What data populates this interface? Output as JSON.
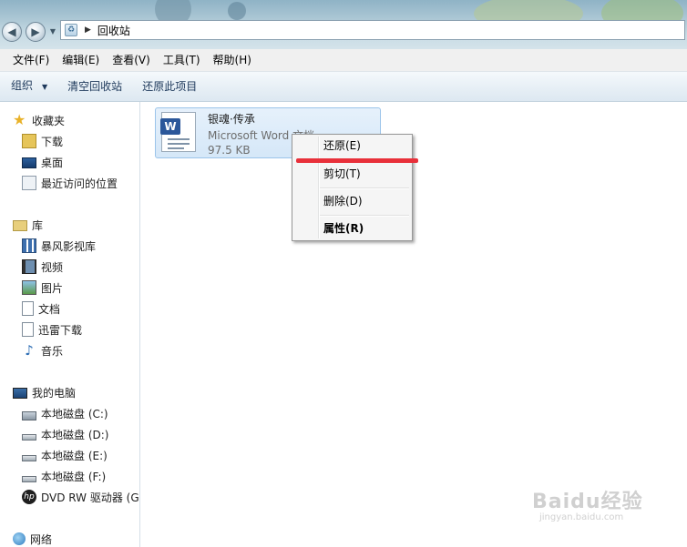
{
  "address": {
    "path": "回收站"
  },
  "menubar": {
    "items": [
      {
        "label": "文件(F)"
      },
      {
        "label": "编辑(E)"
      },
      {
        "label": "查看(V)"
      },
      {
        "label": "工具(T)"
      },
      {
        "label": "帮助(H)"
      }
    ]
  },
  "toolbar": {
    "organize": "组织",
    "empty_bin": "清空回收站",
    "restore_item": "还原此项目"
  },
  "nav": {
    "favorites": {
      "label": "收藏夹",
      "items": [
        "下载",
        "桌面",
        "最近访问的位置"
      ]
    },
    "library": {
      "label": "库",
      "items": [
        "暴风影视库",
        "视频",
        "图片",
        "文档",
        "迅雷下载",
        "音乐"
      ]
    },
    "computer": {
      "label": "我的电脑",
      "items": [
        "本地磁盘 (C:)",
        "本地磁盘 (D:)",
        "本地磁盘 (E:)",
        "本地磁盘 (F:)",
        "DVD RW 驱动器 (G"
      ]
    },
    "network": {
      "label": "网络"
    }
  },
  "file": {
    "name": "银魂·传承",
    "type": "Microsoft Word 文档",
    "size": "97.5 KB"
  },
  "context_menu": {
    "restore": "还原(E)",
    "cut": "剪切(T)",
    "delete": "删除(D)",
    "properties": "属性(R)"
  },
  "watermark": {
    "main": "Baidu经验",
    "sub": "jingyan.baidu.com"
  },
  "colors": {
    "highlight_line": "#e8303a",
    "tile_bg": "#d5e7f8",
    "word_blue": "#2b579a"
  }
}
